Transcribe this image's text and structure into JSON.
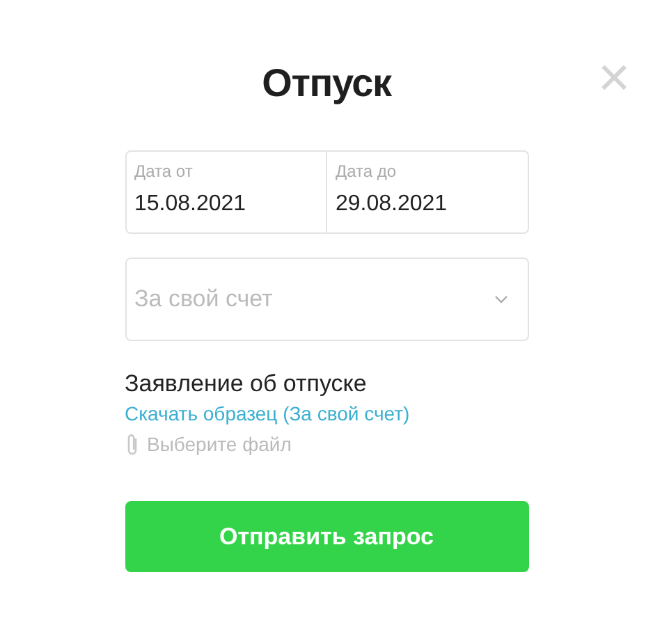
{
  "dialog": {
    "title": "Отпуск",
    "close": "×"
  },
  "dates": [
    {
      "label": "Дата от",
      "value": "15.08.2021"
    },
    {
      "label": "Дата до",
      "value": "29.08.2021"
    }
  ],
  "type_select": {
    "placeholder": "За свой счет"
  },
  "attachment": {
    "label": "Заявление об отпуске",
    "download_link": "Скачать образец (За свой счет)",
    "file_placeholder": "Выберите файл"
  },
  "submit_button": "Отправить запрос"
}
